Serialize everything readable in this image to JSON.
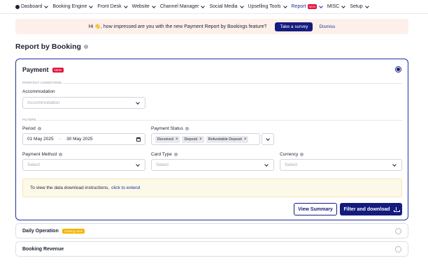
{
  "nav": {
    "items": [
      {
        "label": "Dasboard",
        "active": false
      },
      {
        "label": "Booking Engine",
        "active": false
      },
      {
        "label": "Front Desk",
        "active": false
      },
      {
        "label": "Website",
        "active": false
      },
      {
        "label": "Channel Manager",
        "active": false
      },
      {
        "label": "Social Media",
        "active": false
      },
      {
        "label": "Upselling Tools",
        "active": false
      },
      {
        "label": "Report",
        "active": true,
        "badge": "NEW"
      },
      {
        "label": "MISC",
        "active": false
      },
      {
        "label": "Setup",
        "active": false
      }
    ]
  },
  "banner": {
    "text": "Hi 👋, how impressed are you with the new Payment Report by Bookings feature?",
    "primary_button": "Take a survey",
    "dismiss_link": "Dismiss"
  },
  "page": {
    "title": "Report by Booking"
  },
  "payment_card": {
    "title": "Payment",
    "badge": "NEW",
    "selected": true,
    "printout_section": "PRINTOUT CONDITIONS",
    "filters_section": "FILTERS",
    "accommodation": {
      "label": "Accommodation",
      "placeholder": "Accommodation"
    },
    "period": {
      "label": "Period",
      "from": "01 May 2025",
      "arrow": "→",
      "to": "30 May 2025"
    },
    "payment_status": {
      "label": "Payment Status",
      "chips": [
        "Received",
        "Deposit",
        "Refundable Deposit"
      ]
    },
    "payment_method": {
      "label": "Payment Method",
      "placeholder": "Select"
    },
    "card_type": {
      "label": "Card Type",
      "placeholder": "Select"
    },
    "currency": {
      "label": "Currency",
      "placeholder": "Select"
    },
    "notice": {
      "text": "To view the data download instructions,",
      "link": "click to extend"
    },
    "view_summary_button": "View Summary",
    "filter_download_button": "Filter and download"
  },
  "other_reports": [
    {
      "title": "Daily Operation",
      "badge": "Coming soon"
    },
    {
      "title": "Booking Revenue",
      "badge": ""
    }
  ],
  "colors": {
    "primary": "#141c7e",
    "new_badge": "#e3143c",
    "coming_soon_badge": "#f5b400",
    "banner_bg": "#fdf0ea",
    "notice_bg": "#fdf9e8"
  }
}
